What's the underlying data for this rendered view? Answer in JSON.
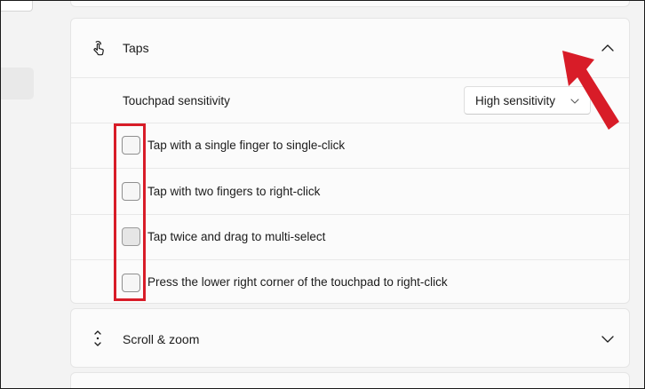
{
  "taps_section": {
    "title": "Taps",
    "icon": "tap-gesture-icon",
    "expanded": true,
    "sensitivity": {
      "label": "Touchpad sensitivity",
      "selected_value": "High sensitivity"
    },
    "options": [
      {
        "label": "Tap with a single finger to single-click",
        "checked": false
      },
      {
        "label": "Tap with two fingers to right-click",
        "checked": false
      },
      {
        "label": "Tap twice and drag to multi-select",
        "checked": false
      },
      {
        "label": "Press the lower right corner of the touchpad to right-click",
        "checked": false
      }
    ]
  },
  "scroll_section": {
    "title": "Scroll & zoom",
    "icon": "scroll-arrows-icon",
    "expanded": false
  },
  "annotation": {
    "color": "#d81c28"
  }
}
